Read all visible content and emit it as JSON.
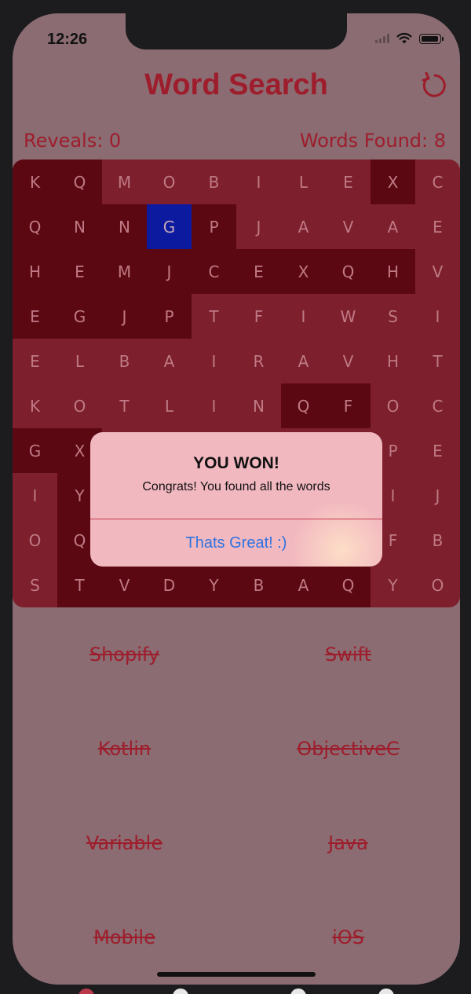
{
  "status_bar": {
    "time": "12:26"
  },
  "app": {
    "title": "Word Search"
  },
  "stats": {
    "reveals": "Reveals: 0",
    "words_found": "Words Found: 8"
  },
  "grid": {
    "rows": [
      [
        "K",
        "Q",
        "M",
        "O",
        "B",
        "I",
        "L",
        "E",
        "X",
        "C"
      ],
      [
        "Q",
        "N",
        "N",
        "G",
        "P",
        "J",
        "A",
        "V",
        "A",
        "E"
      ],
      [
        "H",
        "E",
        "M",
        "J",
        "C",
        "E",
        "X",
        "Q",
        "H",
        "V"
      ],
      [
        "E",
        "G",
        "J",
        "P",
        "T",
        "F",
        "I",
        "W",
        "S",
        "I"
      ],
      [
        "E",
        "L",
        "B",
        "A",
        "I",
        "R",
        "A",
        "V",
        "H",
        "T"
      ],
      [
        "K",
        "O",
        "T",
        "L",
        "I",
        "N",
        "Q",
        "F",
        "O",
        "C"
      ],
      [
        "G",
        "X",
        "",
        "",
        "",
        "",
        "",
        "",
        "P",
        "E"
      ],
      [
        "I",
        "Y",
        "",
        "",
        "",
        "",
        "",
        "",
        "I",
        "J"
      ],
      [
        "O",
        "Q",
        "",
        "",
        "",
        "",
        "",
        "",
        "F",
        "B"
      ],
      [
        "S",
        "T",
        "V",
        "D",
        "Y",
        "B",
        "A",
        "Q",
        "Y",
        "O"
      ]
    ],
    "dark_cells": [
      [
        0,
        0
      ],
      [
        0,
        1
      ],
      [
        0,
        8
      ],
      [
        1,
        0
      ],
      [
        1,
        1
      ],
      [
        1,
        2
      ],
      [
        1,
        4
      ],
      [
        2,
        0
      ],
      [
        2,
        1
      ],
      [
        2,
        2
      ],
      [
        2,
        3
      ],
      [
        2,
        4
      ],
      [
        2,
        5
      ],
      [
        2,
        6
      ],
      [
        2,
        7
      ],
      [
        2,
        8
      ],
      [
        3,
        0
      ],
      [
        3,
        1
      ],
      [
        3,
        2
      ],
      [
        3,
        3
      ],
      [
        5,
        6
      ],
      [
        5,
        7
      ],
      [
        6,
        0
      ],
      [
        6,
        1
      ],
      [
        7,
        1
      ],
      [
        8,
        1
      ],
      [
        9,
        1
      ],
      [
        9,
        2
      ],
      [
        9,
        3
      ],
      [
        9,
        4
      ],
      [
        9,
        5
      ],
      [
        9,
        6
      ],
      [
        9,
        7
      ]
    ],
    "selected_cell": [
      1,
      3
    ],
    "colors": {
      "dark": "#5c0812",
      "selected": "#0c1aa0"
    }
  },
  "words": [
    "Shopify",
    "Swift",
    "Kotlin",
    "ObjectiveC",
    "Variable",
    "Java",
    "Mobile",
    "iOS"
  ],
  "alert": {
    "title": "YOU WON!",
    "message": "Congrats! You found all the words",
    "button": "Thats Great! :)"
  }
}
